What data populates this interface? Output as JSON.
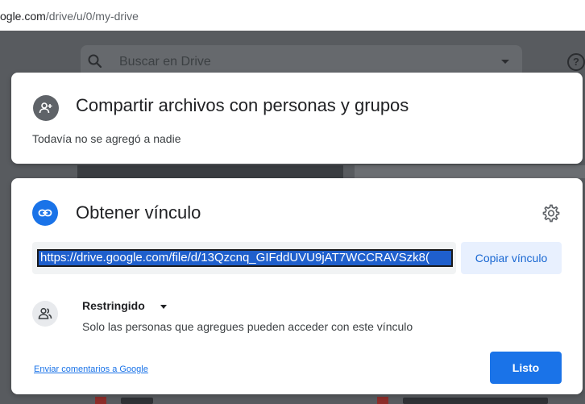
{
  "browser": {
    "url_domain": "ogle.com",
    "url_path": "/drive/u/0/my-drive"
  },
  "drive": {
    "search_placeholder": "Buscar en Drive",
    "help_glyph": "?"
  },
  "share": {
    "title": "Compartir archivos con personas y grupos",
    "subtitle": "Todavía no se agregó a nadie"
  },
  "link": {
    "title": "Obtener vínculo",
    "url": "https://drive.google.com/file/d/13Qzcnq_GIFddUVU9jAT7WCCRAVSzk8(",
    "copy_label": "Copiar vínculo",
    "access_label": "Restringido",
    "access_description": "Solo las personas que agregues pueden acceder con este vínculo",
    "feedback_label": "Enviar comentarios a Google",
    "done_label": "Listo"
  },
  "icons": {
    "share": "person-add-icon",
    "link": "link-icon",
    "settings": "gear-icon",
    "access": "people-icon",
    "search": "search-icon"
  },
  "colors": {
    "accent": "#1a73e8",
    "copy_button_bg": "#e8f0fe",
    "share_icon_bg": "#5f6368"
  }
}
